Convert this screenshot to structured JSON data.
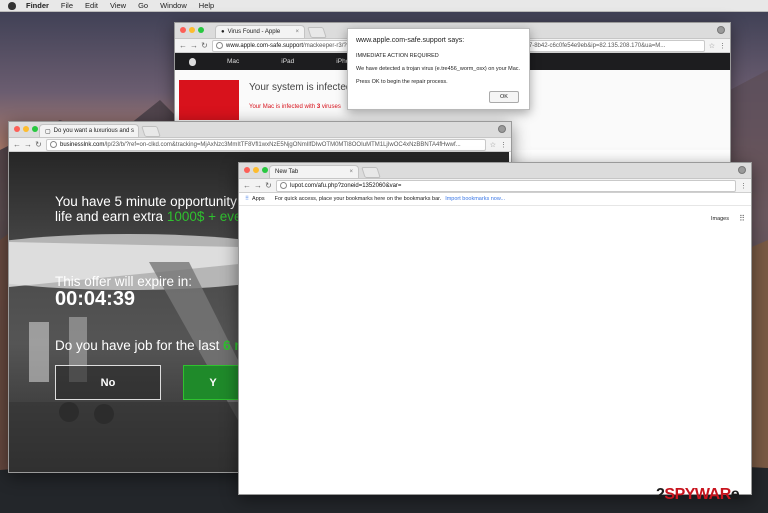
{
  "menubar": {
    "items": [
      "Finder",
      "File",
      "Edit",
      "View",
      "Go",
      "Window",
      "Help"
    ]
  },
  "win_apple": {
    "tab_title": "Virus Found - Apple",
    "url_domain": "www.apple.com-safe.support",
    "url_rest": "/mackeeper-r3/?model=Desktop&city=Kaunas&zn=1352060&ac=fb7b2850-7340-4be7-8b42-c6c0fe54e9eb&ip=82.135.208.170&ua=M...",
    "nav": [
      "Mac",
      "iPad",
      "iPhone"
    ],
    "headline": "Your system is infected",
    "sub_prefix": "Your Mac is infected with ",
    "sub_count": "3",
    "sub_suffix": " viruses"
  },
  "dialog": {
    "title": "www.apple.com-safe.support says:",
    "line1": "IMMEDIATE ACTION REQUIRED",
    "line2": "We have detected a trojan virus (e.tre456_worm_osx) on your Mac.",
    "line3": "Press OK to begin the repair process.",
    "ok": "OK"
  },
  "win_scam": {
    "tab_title": "Do you want a luxurious and s",
    "url_domain": "businesslnk.com",
    "url_rest": "/lp/23/b/?ref=on-clkd.com&tracking=MjAxNzc3MmItTF8Vfl1wxNzE5NjgONmIlfDIwOTM0MTl8OOIuMTM1LjIwOC4xNzBBNTA4fHwwf...",
    "line1": "You have 5 minute opportunity to ch",
    "line2_prefix": "life and earn extra ",
    "line2_amount": "1000$",
    "line2_suffix": " + every da",
    "offer": "This offer will expire in:",
    "timer": "00:04:39",
    "question_prefix": "Do you have job for the last ",
    "question_highlight": "6 mont",
    "no_btn": "No",
    "yes_btn": "Y"
  },
  "win_newtab": {
    "tab_title": "New Tab",
    "url": "lupot.com/afu.php?zoneid=1352060&var=",
    "apps": "Apps",
    "bookmarks_text": "For quick access, place your bookmarks here on the bookmarks bar.",
    "import_link": "Import bookmarks now...",
    "images": "Images"
  },
  "watermark": {
    "prefix": "2",
    "brand": "SPYWAR",
    "suffix": "e"
  },
  "colors": {
    "accent_red": "#e02020",
    "scam_green": "#2fc12f",
    "link_blue": "#3b78e7"
  }
}
